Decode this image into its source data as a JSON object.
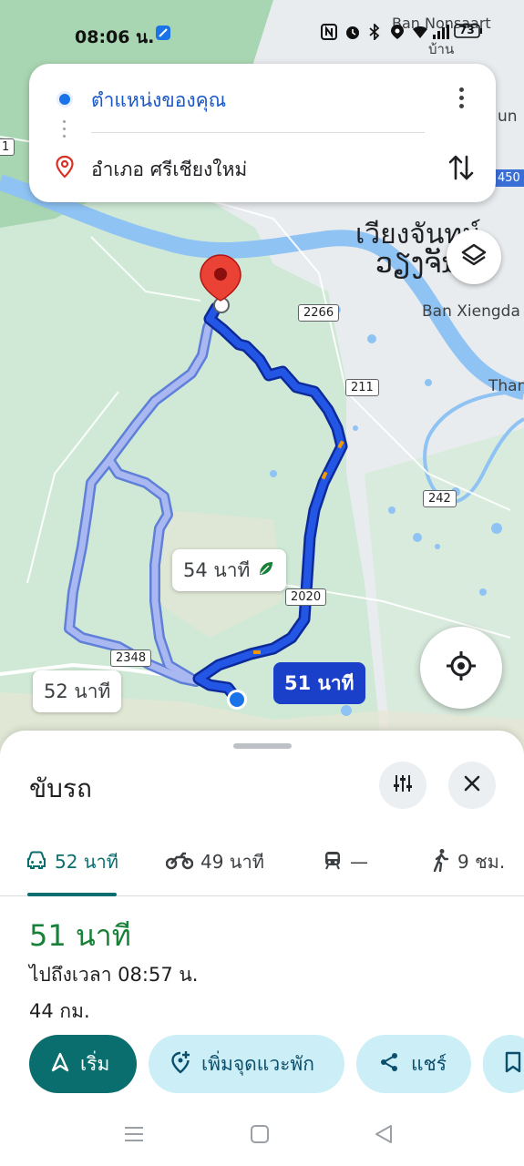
{
  "status_bar": {
    "time": "08:06 น.",
    "icons": [
      "nfc-icon",
      "alarm-icon",
      "bluetooth-icon",
      "location-icon",
      "signal-icon",
      "battery-icon"
    ],
    "battery": "73"
  },
  "route_card": {
    "origin": "ตำแหน่งของคุณ",
    "destination": "อำเภอ ศรีเชียงใหม่"
  },
  "map": {
    "labels": {
      "town_th": "เวียงจันทน์",
      "town_lao": "ວຽງຈັນ",
      "ban_xiengda": "Ban Xiengda",
      "ban_nonsaart": "Ban Nonsaart",
      "ban_th_small": "บ้าน",
      "than": "Than",
      "un": "un",
      "num_450": "450"
    },
    "road_shields": {
      "r2266": "2266",
      "r211": "211",
      "r242": "242",
      "r2020": "2020",
      "r2348": "2348",
      "r1": "1"
    },
    "route_times": {
      "alt1": "54 นาที",
      "alt2": "52 นาที",
      "main": "51 นาที"
    },
    "colors": {
      "main_route": "#1a3fc8",
      "alt_route": "#a9b8f0",
      "river": "#8fc3f4",
      "land": "#cfe9d6"
    }
  },
  "sheet": {
    "title": "ขับรถ",
    "modes": [
      {
        "icon": "car-icon",
        "label": "52 นาที"
      },
      {
        "icon": "motorcycle-icon",
        "label": "49 นาที"
      },
      {
        "icon": "train-icon",
        "label": "—"
      },
      {
        "icon": "walk-icon",
        "label": "9 ชม."
      }
    ],
    "duration": "51 นาที",
    "arrival": "ไปถึงเวลา 08:57 น.",
    "distance": "44 กม.",
    "actions": {
      "start": "เริ่ม",
      "add_stop": "เพิ่มจุดแวะพัก",
      "share": "แชร์"
    }
  }
}
